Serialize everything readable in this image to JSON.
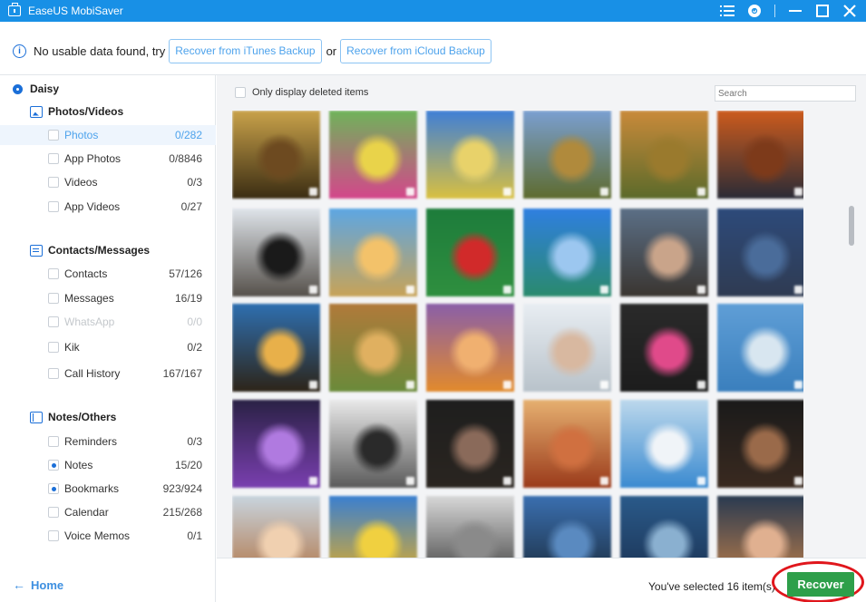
{
  "window": {
    "title": "EaseUS MobiSaver",
    "icons": [
      "menu-icon",
      "help-icon",
      "minimize-icon",
      "maximize-icon",
      "close-icon"
    ]
  },
  "notice": {
    "message": "No usable data found, try",
    "itunes_button": "Recover from iTunes Backup",
    "or_text": "or",
    "icloud_button": "Recover from iCloud Backup"
  },
  "sidebar": {
    "device": "Daisy",
    "categories": [
      {
        "label": "Photos/Videos",
        "icon": "photos-icon",
        "items": [
          {
            "label": "Photos",
            "count": "0/282",
            "selected": true
          },
          {
            "label": "App Photos",
            "count": "0/8846"
          },
          {
            "label": "Videos",
            "count": "0/3"
          },
          {
            "label": "App Videos",
            "count": "0/27"
          }
        ]
      },
      {
        "label": "Contacts/Messages",
        "icon": "contacts-icon",
        "items": [
          {
            "label": "Contacts",
            "count": "57/126"
          },
          {
            "label": "Messages",
            "count": "16/19"
          },
          {
            "label": "WhatsApp",
            "count": "0/0",
            "disabled": true
          },
          {
            "label": "Kik",
            "count": "0/2"
          },
          {
            "label": "Call History",
            "count": "167/167"
          }
        ]
      },
      {
        "label": "Notes/Others",
        "icon": "notes-icon",
        "items": [
          {
            "label": "Reminders",
            "count": "0/3"
          },
          {
            "label": "Notes",
            "count": "15/20",
            "checked": true
          },
          {
            "label": "Bookmarks",
            "count": "923/924",
            "checked": true
          },
          {
            "label": "Calendar",
            "count": "215/268"
          },
          {
            "label": "Voice Memos",
            "count": "0/1"
          }
        ]
      }
    ],
    "home_label": "Home"
  },
  "main": {
    "only_deleted_label": "Only display deleted items",
    "search_placeholder": "Search",
    "thumbnails": [
      {
        "top": "#c9a24a",
        "bottom": "#3a2c12",
        "accent": "#6d4a20"
      },
      {
        "top": "#6fb35a",
        "bottom": "#d4468b",
        "accent": "#e9d34a"
      },
      {
        "top": "#3f7fd6",
        "bottom": "#d9c040",
        "accent": "#e8d26a"
      },
      {
        "top": "#7a9fd1",
        "bottom": "#5e6b2e",
        "accent": "#b08a3c"
      },
      {
        "top": "#c98a3a",
        "bottom": "#5b6a2a",
        "accent": "#9a7a2d"
      },
      {
        "top": "#cc5b1d",
        "bottom": "#2b2b36",
        "accent": "#7d3a1a"
      },
      {
        "top": "#dfe4ea",
        "bottom": "#55504a",
        "accent": "#1a1a1a"
      },
      {
        "top": "#5da6e3",
        "bottom": "#c8a357",
        "accent": "#f3c26a"
      },
      {
        "top": "#1d7c3b",
        "bottom": "#2f8f3f",
        "accent": "#d12a2a"
      },
      {
        "top": "#2f7fe0",
        "bottom": "#2a8a6d",
        "accent": "#9cc7f0"
      },
      {
        "top": "#5b6f86",
        "bottom": "#3a3530",
        "accent": "#c9a48a"
      },
      {
        "top": "#2d4a7a",
        "bottom": "#2f3b52",
        "accent": "#4a6c9a"
      },
      {
        "top": "#2e6fb0",
        "bottom": "#2d2418",
        "accent": "#e8b04a"
      },
      {
        "top": "#b07a3a",
        "bottom": "#6a8a3a",
        "accent": "#e0b060"
      },
      {
        "top": "#8a5fa8",
        "bottom": "#e28a2c",
        "accent": "#f0b070"
      },
      {
        "top": "#e8edf2",
        "bottom": "#b8c2ca",
        "accent": "#d8b8a0"
      },
      {
        "top": "#2a2a2a",
        "bottom": "#1c1c1c",
        "accent": "#e04a8a"
      },
      {
        "top": "#5f9ed6",
        "bottom": "#3a7fbd",
        "accent": "#d8e6f0"
      },
      {
        "top": "#2a2145",
        "bottom": "#7a3fb0",
        "accent": "#b07ae0"
      },
      {
        "top": "#e9e9e9",
        "bottom": "#5a5a5a",
        "accent": "#2a2a2a"
      },
      {
        "top": "#1e1e1e",
        "bottom": "#2a2520",
        "accent": "#8a6a5a"
      },
      {
        "top": "#e6b070",
        "bottom": "#9a3a1a",
        "accent": "#d07040"
      },
      {
        "top": "#bcd8ec",
        "bottom": "#3a8ad0",
        "accent": "#f0f4f8"
      },
      {
        "top": "#1a1a1a",
        "bottom": "#3a2a20",
        "accent": "#9a6a4a"
      },
      {
        "top": "#c8d4de",
        "bottom": "#b07040",
        "accent": "#f0d0b0"
      },
      {
        "top": "#3a7fd0",
        "bottom": "#e8b020",
        "accent": "#f0d040"
      },
      {
        "top": "#d8d8d8",
        "bottom": "#3a3a3a",
        "accent": "#8a8a8a"
      },
      {
        "top": "#3a6fb0",
        "bottom": "#1a2a3a",
        "accent": "#5a8ac0"
      },
      {
        "top": "#2a5a8a",
        "bottom": "#1a3050",
        "accent": "#8ab0d0"
      },
      {
        "top": "#2a3a50",
        "bottom": "#c0804a",
        "accent": "#e0b090"
      }
    ]
  },
  "footer": {
    "selected_text": "You've selected 16 item(s)",
    "recover_label": "Recover"
  },
  "colors": {
    "accent": "#1890e6",
    "recover": "#2e9f4a",
    "highlight": "#e0161c"
  }
}
